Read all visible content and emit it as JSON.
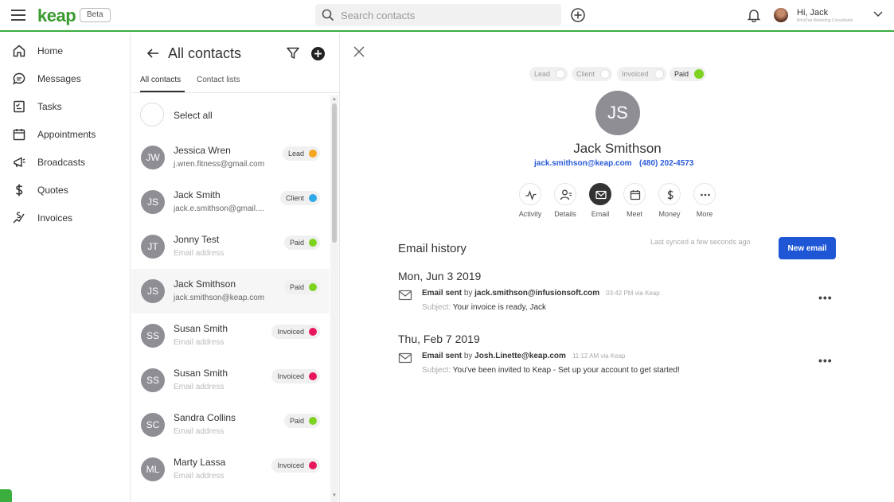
{
  "app": {
    "logo": "keap",
    "beta": "Beta",
    "search_placeholder": "Search contacts",
    "user_greeting": "Hi, Jack",
    "user_org": "BrickTop Marketing Consultants"
  },
  "nav": {
    "items": [
      {
        "label": "Home",
        "icon": "home-icon"
      },
      {
        "label": "Messages",
        "icon": "messages-icon"
      },
      {
        "label": "Tasks",
        "icon": "tasks-icon"
      },
      {
        "label": "Appointments",
        "icon": "calendar-icon"
      },
      {
        "label": "Broadcasts",
        "icon": "megaphone-icon"
      },
      {
        "label": "Quotes",
        "icon": "dollar-icon"
      },
      {
        "label": "Invoices",
        "icon": "invoice-icon"
      }
    ]
  },
  "contacts": {
    "title": "All contacts",
    "tabs": [
      "All contacts",
      "Contact lists"
    ],
    "select_all": "Select all",
    "list": [
      {
        "initials": "JW",
        "name": "Jessica Wren",
        "email": "j.wren.fitness@gmail.com",
        "email_placeholder": false,
        "status": "Lead",
        "status_color": "#f5a623"
      },
      {
        "initials": "JS",
        "name": "Jack Smith",
        "email": "jack.e.smithson@gmail....",
        "email_placeholder": false,
        "status": "Client",
        "status_color": "#2fa8e6"
      },
      {
        "initials": "JT",
        "name": "Jonny Test",
        "email": "Email address",
        "email_placeholder": true,
        "status": "Paid",
        "status_color": "#7ed321"
      },
      {
        "initials": "JS",
        "name": "Jack Smithson",
        "email": "jack.smithson@keap.com",
        "email_placeholder": false,
        "status": "Paid",
        "status_color": "#7ed321"
      },
      {
        "initials": "SS",
        "name": "Susan Smith",
        "email": "Email address",
        "email_placeholder": true,
        "status": "Invoiced",
        "status_color": "#e8175d"
      },
      {
        "initials": "SS",
        "name": "Susan Smith",
        "email": "Email address",
        "email_placeholder": true,
        "status": "Invoiced",
        "status_color": "#e8175d"
      },
      {
        "initials": "SC",
        "name": "Sandra Collins",
        "email": "Email address",
        "email_placeholder": true,
        "status": "Paid",
        "status_color": "#7ed321"
      },
      {
        "initials": "ML",
        "name": "Marty Lassa",
        "email": "Email address",
        "email_placeholder": true,
        "status": "Invoiced",
        "status_color": "#e8175d"
      }
    ]
  },
  "detail": {
    "stages": [
      "Lead",
      "Client",
      "Invoiced",
      "Paid"
    ],
    "active_stage": "Paid",
    "initials": "JS",
    "name": "Jack Smithson",
    "email": "jack.smithson@keap.com",
    "phone": "(480) 202-4573",
    "actions": [
      "Activity",
      "Details",
      "Email",
      "Meet",
      "Money",
      "More"
    ],
    "active_action": "Email",
    "email_history": {
      "title": "Email history",
      "sync_status": "Last synced a few seconds ago",
      "new_email_label": "New email",
      "entries": [
        {
          "date": "Mon, Jun 3 2019",
          "sent_label": "Email sent",
          "by": "by",
          "sender": "jack.smithson@infusionsoft.com",
          "meta": "03:42 PM via Keap",
          "subject_label": "Subject:",
          "subject": "Your invoice is ready, Jack"
        },
        {
          "date": "Thu, Feb 7 2019",
          "sent_label": "Email sent",
          "by": "by",
          "sender": "Josh.Linette@keap.com",
          "meta": "11:12 AM via Keap",
          "subject_label": "Subject:",
          "subject": "You've been invited to Keap - Set up your account to get started!"
        }
      ]
    }
  }
}
